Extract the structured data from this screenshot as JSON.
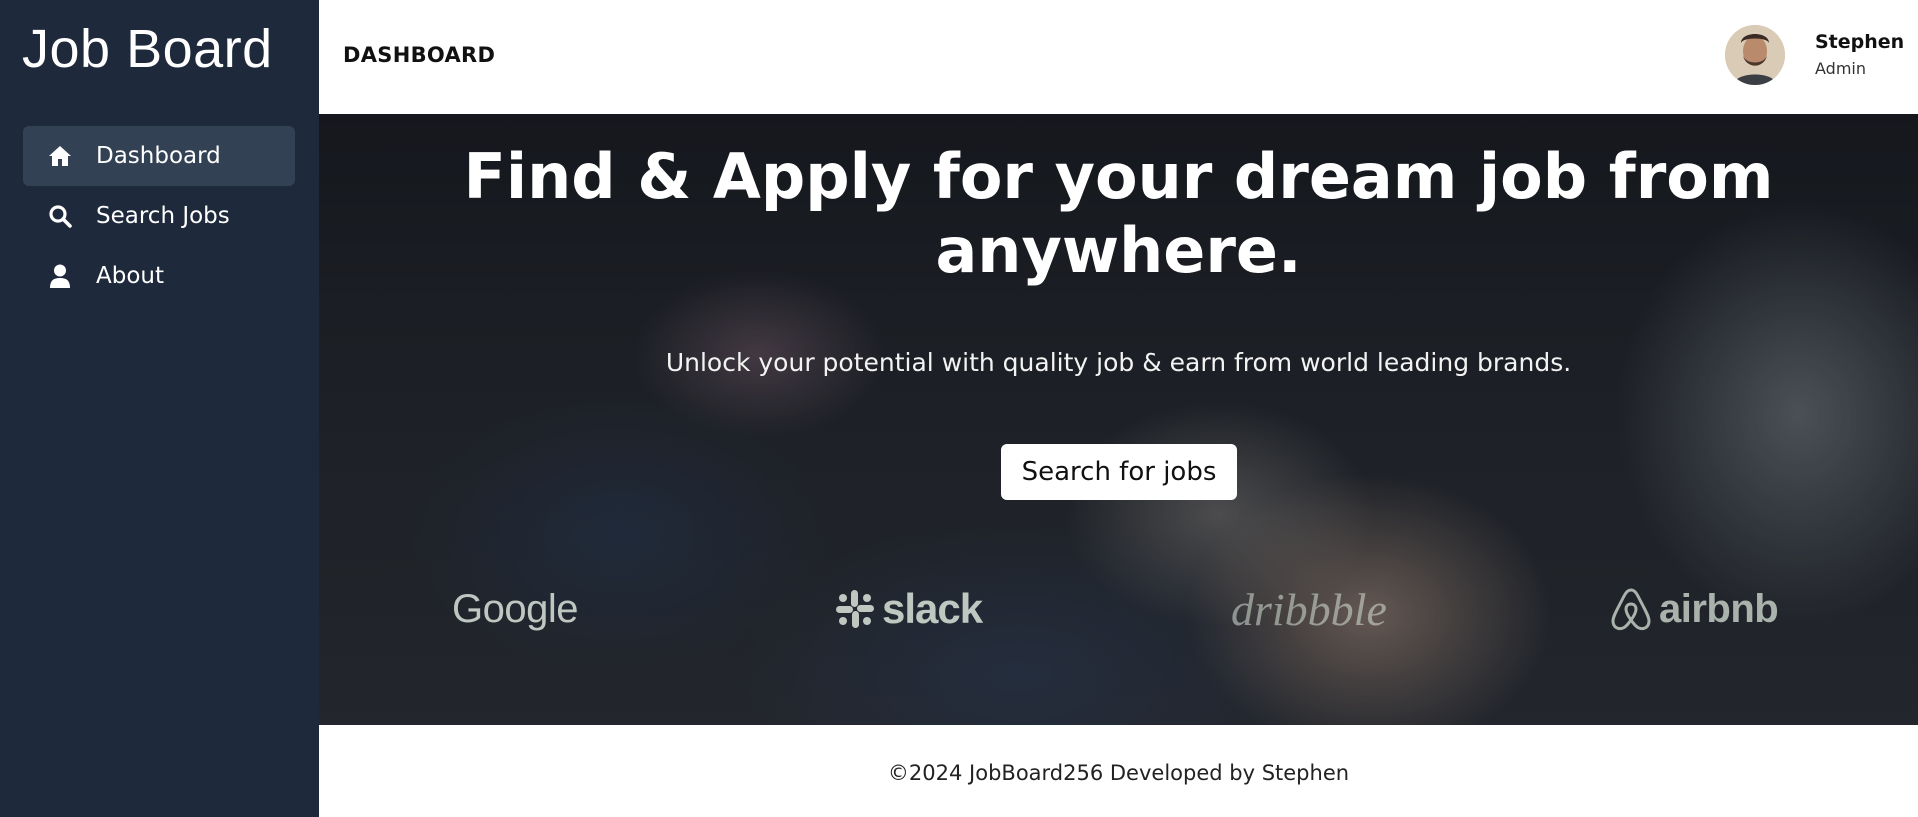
{
  "sidebar": {
    "brand": "Job Board",
    "items": [
      {
        "label": "Dashboard",
        "icon": "home-icon",
        "active": true
      },
      {
        "label": "Search Jobs",
        "icon": "search-icon",
        "active": false
      },
      {
        "label": "About",
        "icon": "user-icon",
        "active": false
      }
    ]
  },
  "header": {
    "title": "DASHBOARD",
    "user": {
      "name": "Stephen",
      "role": "Admin",
      "avatar": "user-avatar"
    }
  },
  "hero": {
    "title": "Find & Apply for your dream job from anywhere.",
    "subtitle": "Unlock your potential with quality job & earn from world leading brands.",
    "button_label": "Search for jobs",
    "brands": [
      "Google",
      "slack",
      "dribbble",
      "airbnb"
    ]
  },
  "footer": {
    "text": "©2024 JobBoard256 Developed by Stephen"
  },
  "colors": {
    "sidebar_bg": "#1e293b",
    "sidebar_active": "#334155",
    "header_bg": "#ffffff"
  }
}
